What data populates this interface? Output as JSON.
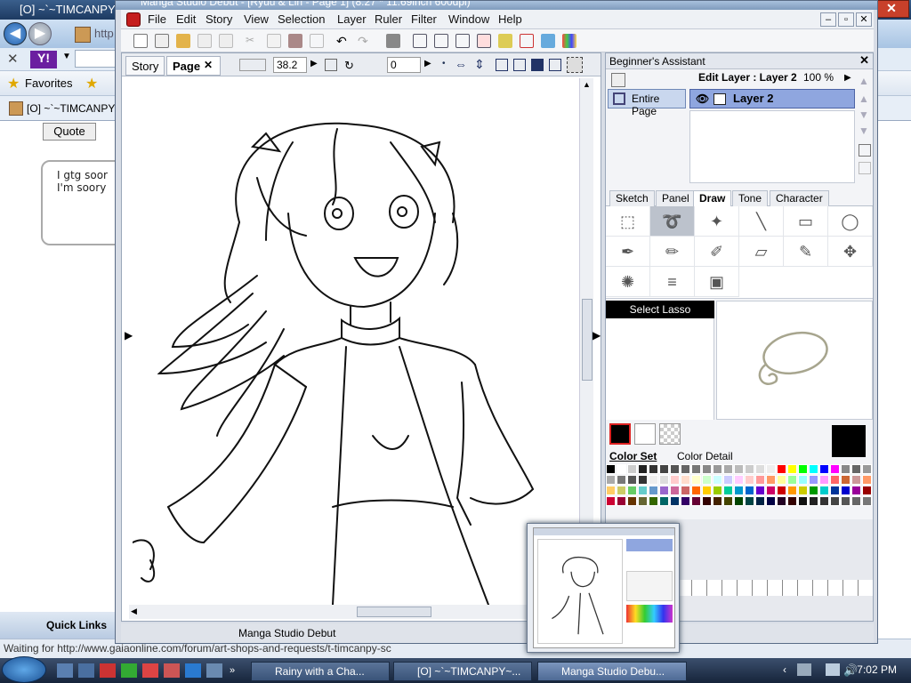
{
  "ie": {
    "title": "[O] ~`~TIMCANPY~",
    "close": "✕",
    "address_prefix": "http",
    "favorites_label": "Favorites",
    "tab_title": "[O] ~`~TIMCANPY~",
    "quote_label": "Quote",
    "chat_line1": "I gtg soor",
    "chat_line2": "I'm soory",
    "quick_links": "Quick Links",
    "status": "Waiting for http://www.gaiaonline.com/forum/art-shops-and-requests/t-timcanpy-sc"
  },
  "ms": {
    "title": "Manga Studio Debut - [Ryuu & Lin - Page 1] (8.27 * 11.69inch 600dpi)",
    "menus": [
      "File",
      "Edit",
      "Story",
      "View",
      "Selection",
      "Layer",
      "Ruler",
      "Filter",
      "Window",
      "Help"
    ],
    "tabs": {
      "story": "Story",
      "page": "Page",
      "page_close": "✕"
    },
    "zoom": "38.2",
    "rotation": "0",
    "status": "Manga Studio Debut"
  },
  "assistant": {
    "title": "Beginner's Assistant",
    "close": "✕",
    "edit_layer": "Edit Layer : Layer 2",
    "opacity": "100 %",
    "entire_page": "Entire Page",
    "layer_name": "Layer 2",
    "tool_tabs": [
      "Sketch",
      "Panel",
      "Draw",
      "Tone",
      "Character"
    ],
    "active_tool": "Select Lasso",
    "color_tabs": [
      "Color Set",
      "Color Detail"
    ]
  },
  "taskbar": {
    "tasks": [
      "Rainy with a Cha...",
      "[O] ~`~TIMCANPY~...",
      "Manga Studio Debu..."
    ],
    "clock": "7:02 PM"
  },
  "colors": {
    "layer_highlight": "#8fa6df",
    "accent_red": "#c51e1e"
  }
}
